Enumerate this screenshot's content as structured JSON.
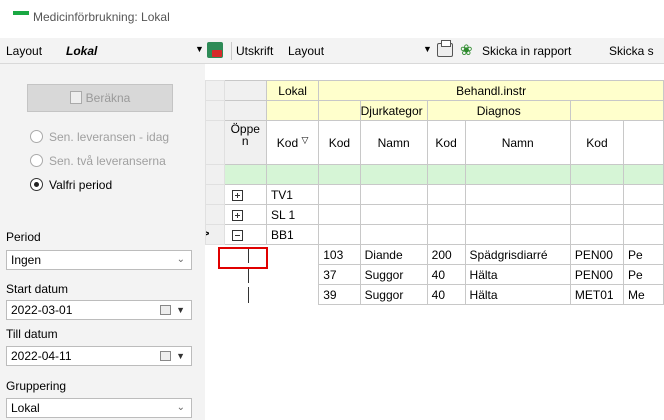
{
  "window": {
    "title": "Medicinförbrukning: Lokal"
  },
  "toolbar": {
    "layout_label": "Layout",
    "layout_value": "Lokal",
    "utskrift_label": "Utskrift",
    "utskrift_value": "Layout",
    "submit_label": "Skicka in rapport",
    "submit2_label": "Skicka s"
  },
  "sidebar": {
    "calc_label": "Beräkna",
    "radio1": "Sen. leveransen - idag",
    "radio2": "Sen. två leveranserna",
    "radio3": "Valfri period",
    "period_label": "Period",
    "period_value": "Ingen",
    "start_label": "Start datum",
    "start_value": "2022-03-01",
    "till_label": "Till datum",
    "till_value": "2022-04-11",
    "group_label": "Gruppering",
    "group_value": "Lokal"
  },
  "grid": {
    "hdr_lokal": "Lokal",
    "hdr_behandl": "Behandl.instr",
    "hdr_djurkategori": "Djurkategor",
    "hdr_diagnos": "Diagnos",
    "col_oppen": "Öppe n",
    "col_kod": "Kod",
    "col_kod2": "Kod",
    "col_namn": "Namn",
    "col_kod3": "Kod",
    "col_namn2": "Namn",
    "col_kod4": "Kod",
    "groups": [
      "TV1",
      "SL 1",
      "BB1"
    ],
    "rows": [
      {
        "kod": "103",
        "namn": "Diande",
        "diag_kod": "200",
        "diag_namn": "Spädgrisdiarré",
        "med_kod": "PEN00",
        "more": "Pe"
      },
      {
        "kod": "37",
        "namn": "Suggor",
        "diag_kod": "40",
        "diag_namn": "Hälta",
        "med_kod": "PEN00",
        "more": "Pe"
      },
      {
        "kod": "39",
        "namn": "Suggor",
        "diag_kod": "40",
        "diag_namn": "Hälta",
        "med_kod": "MET01",
        "more": "Me"
      }
    ]
  }
}
